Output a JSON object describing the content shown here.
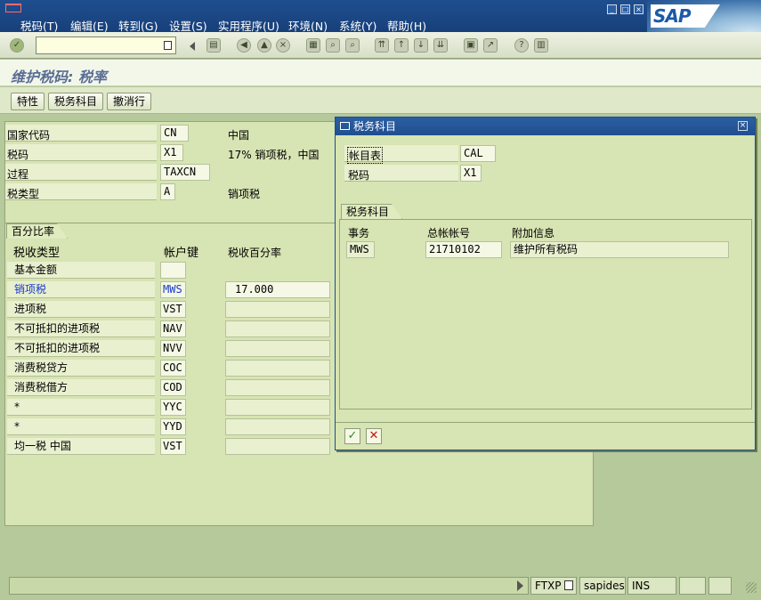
{
  "menu": {
    "items": [
      "税码(T)",
      "编辑(E)",
      "转到(G)",
      "设置(S)",
      "实用程序(U)",
      "环境(N)",
      "系统(Y)",
      "帮助(H)"
    ],
    "logo": "SAP"
  },
  "page": {
    "title": "维护税码: 税率"
  },
  "app_toolbar": {
    "buttons": [
      "特性",
      "税务科目",
      "撤消行"
    ]
  },
  "header_fields": [
    {
      "label": "国家代码",
      "value": "CN",
      "desc": "中国"
    },
    {
      "label": "税码",
      "value": "X1",
      "desc": "17% 销项税，中国"
    },
    {
      "label": "过程",
      "value": "TAXCN",
      "desc": ""
    },
    {
      "label": "税类型",
      "value": "A",
      "desc": "销项税"
    }
  ],
  "rates": {
    "group_title": "百分比率",
    "col_type": "税收类型",
    "col_key": "帐户键",
    "col_pct": "税收百分率",
    "rows": [
      {
        "type": "基本金额",
        "key": "",
        "pct": ""
      },
      {
        "type": "销项税",
        "key": "MWS",
        "pct": "17.000"
      },
      {
        "type": "进项税",
        "key": "VST",
        "pct": ""
      },
      {
        "type": "不可抵扣的进项税",
        "key": "NAV",
        "pct": ""
      },
      {
        "type": "不可抵扣的进项税",
        "key": "NVV",
        "pct": ""
      },
      {
        "type": "消费税贷方",
        "key": "COC",
        "pct": ""
      },
      {
        "type": "消费税借方",
        "key": "COD",
        "pct": ""
      },
      {
        "type": "*",
        "key": "YYC",
        "pct": ""
      },
      {
        "type": "*",
        "key": "YYD",
        "pct": ""
      },
      {
        "type": "均一税 中国",
        "key": "VST",
        "pct": ""
      }
    ]
  },
  "dialog": {
    "title": "税务科目",
    "fields": [
      {
        "label": "帐目表",
        "value": "CAL"
      },
      {
        "label": "税码",
        "value": "X1"
      }
    ],
    "group_title": "税务科目",
    "col_tx": "事务",
    "col_gl": "总帐帐号",
    "col_info": "附加信息",
    "rows": [
      {
        "tx": "MWS",
        "gl": "21710102",
        "info": "维护所有税码"
      }
    ]
  },
  "status": {
    "tx": "FTXP",
    "user": "sapides",
    "mode": "INS"
  },
  "colors": {
    "title_bar": "#1f4e8f",
    "background": "#b5c99a",
    "panel": "#d7e4b3",
    "link": "#1a3acc"
  }
}
